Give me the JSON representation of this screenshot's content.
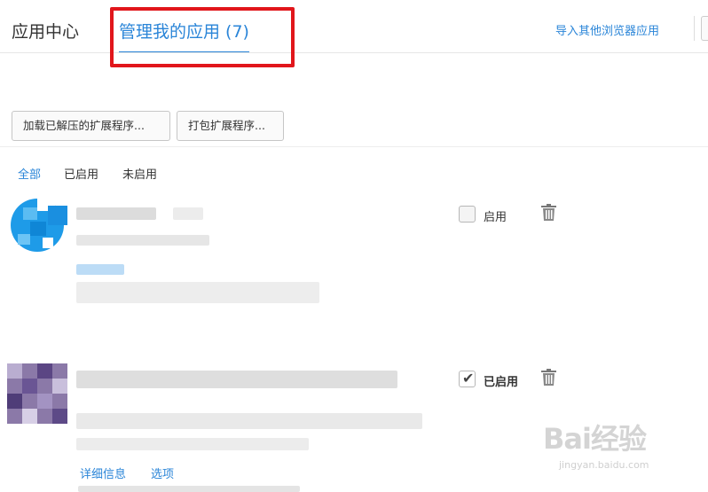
{
  "header": {
    "app_center": "应用中心",
    "manage_tab": "管理我的应用 (7)",
    "import_link": "导入其他浏览器应用"
  },
  "toolbar": {
    "load_unpacked": "加载已解压的扩展程序...",
    "pack_extension": "打包扩展程序..."
  },
  "filters": {
    "all": "全部",
    "enabled": "已启用",
    "disabled": "未启用"
  },
  "extensions": [
    {
      "toggle_label": "启用",
      "enabled": false
    },
    {
      "toggle_label": "已启用",
      "enabled": true,
      "details_link": "详细信息",
      "options_link": "选项"
    }
  ],
  "watermark": {
    "logo": "Bai经验",
    "url": "jingyan.baidu.com"
  },
  "colors": {
    "accent": "#2a85d8",
    "highlight_box": "#e1161b"
  }
}
